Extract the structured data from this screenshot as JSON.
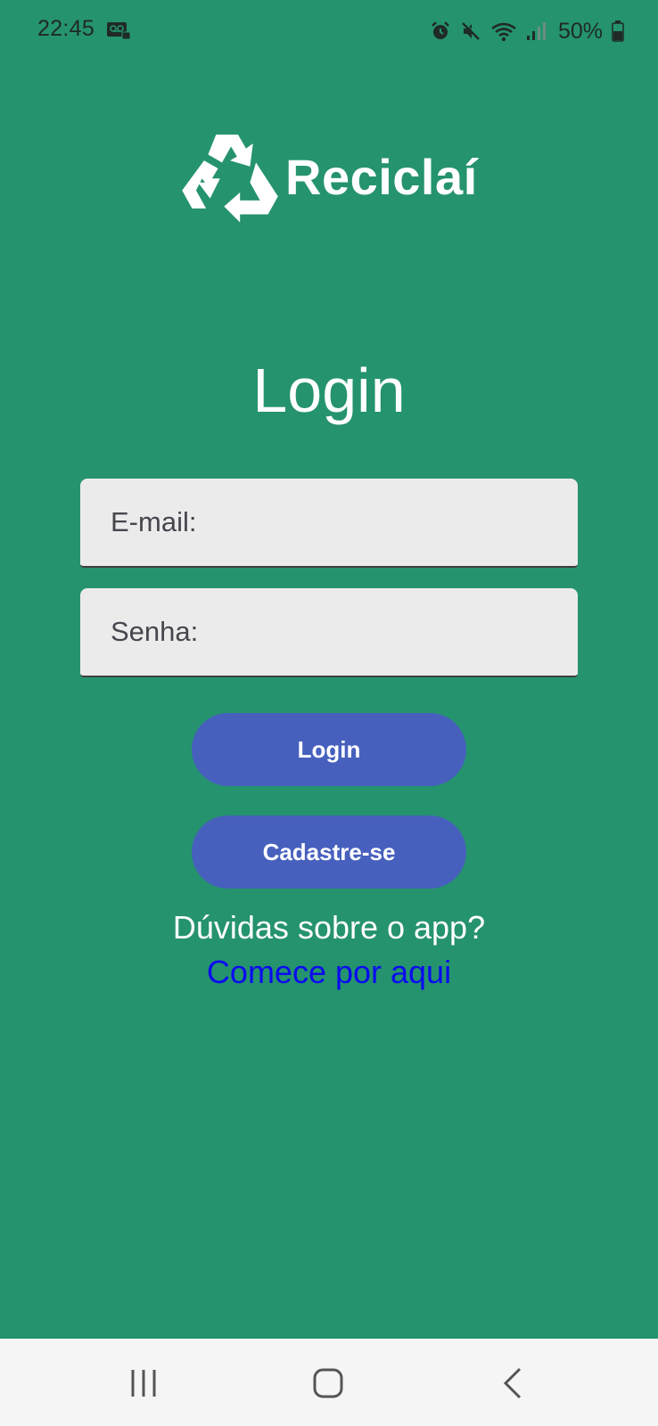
{
  "status_bar": {
    "time": "22:45",
    "battery": "50%",
    "icons": [
      "voicemail-icon",
      "alarm-icon",
      "mute-icon",
      "wifi-icon",
      "signal-icon",
      "battery-icon"
    ]
  },
  "logo": {
    "icon": "recycle-icon",
    "name": "Reciclaí"
  },
  "page": {
    "title": "Login"
  },
  "form": {
    "email_label": "E-mail:",
    "password_label": "Senha:",
    "login_button": "Login",
    "signup_button": "Cadastre-se"
  },
  "help": {
    "question": "Dúvidas sobre o app?",
    "link": "Comece por aqui"
  },
  "nav_bar": {
    "icons": [
      "recent-apps-icon",
      "home-icon",
      "back-icon"
    ]
  },
  "colors": {
    "background": "#25936e",
    "button": "#4760be",
    "input_background": "#ecebec",
    "link": "#0b0bf0"
  }
}
